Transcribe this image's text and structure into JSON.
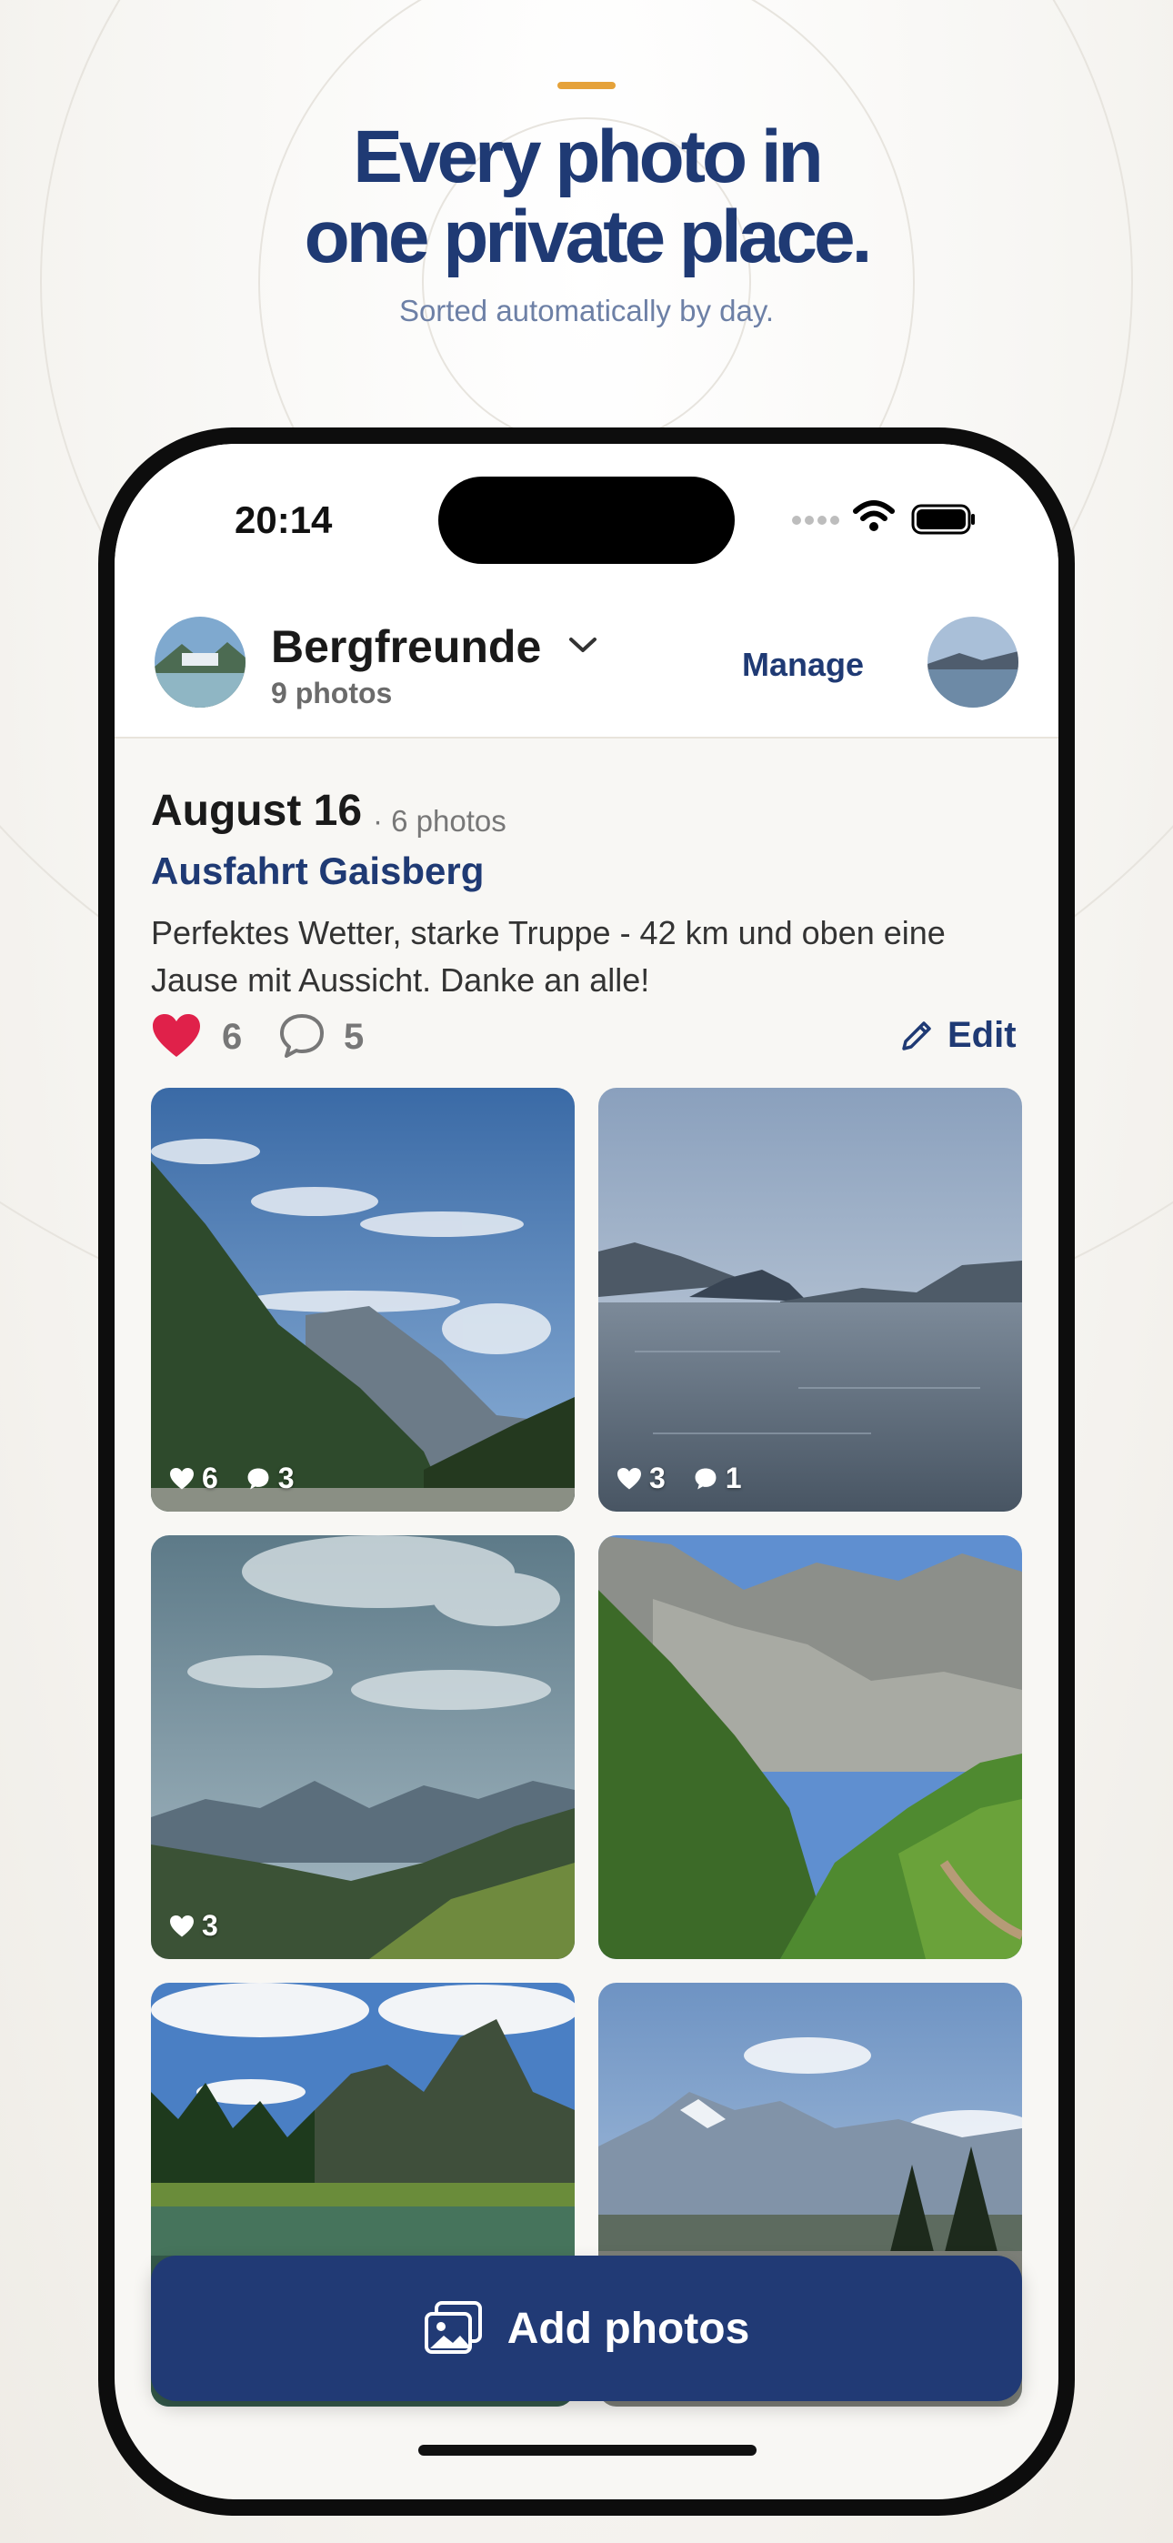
{
  "colors": {
    "accent": "#e5a23a",
    "brand": "#213a75",
    "heart": "#e0214a"
  },
  "hero": {
    "line1": "Every photo in",
    "line2": "one private place.",
    "subtitle": "Sorted automatically by day."
  },
  "status_bar": {
    "time": "20:14"
  },
  "header": {
    "group_name": "Bergfreunde",
    "photo_count": "9 photos",
    "manage_label": "Manage"
  },
  "day": {
    "date": "August 16",
    "count": "· 6 photos",
    "title": "Ausfahrt Gaisberg",
    "description": "Perfektes Wetter, starke Truppe - 42 km und oben eine Jause mit Aussicht. Danke an alle!",
    "likes": "6",
    "comments": "5",
    "edit_label": "Edit"
  },
  "photos": [
    {
      "likes": "6",
      "comments": "3",
      "scene": "valley-mountains"
    },
    {
      "likes": "3",
      "comments": "1",
      "scene": "lake"
    },
    {
      "likes": "3",
      "comments": "",
      "scene": "cloudy-valley"
    },
    {
      "likes": "",
      "comments": "",
      "scene": "green-mountains"
    },
    {
      "likes": "",
      "comments": "",
      "scene": "alpine-lake"
    },
    {
      "likes": "",
      "comments": "",
      "scene": "snowy-peaks"
    }
  ],
  "add_button": {
    "label": "Add photos",
    "icon": "photo-add-icon"
  }
}
